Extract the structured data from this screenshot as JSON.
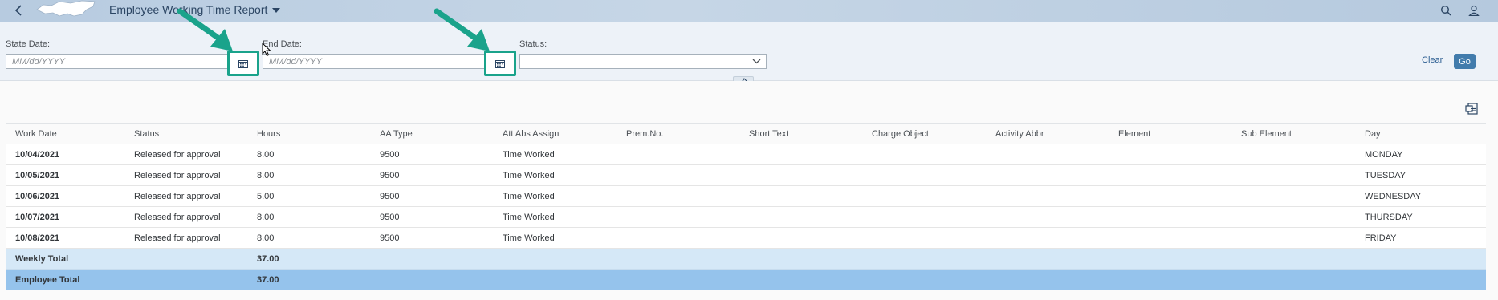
{
  "header": {
    "title": "Employee Working Time Report"
  },
  "filters": {
    "start_label": "State Date:",
    "start_placeholder": "MM/dd/YYYY",
    "end_label": "End Date:",
    "end_placeholder": "MM/dd/YYYY",
    "status_label": "Status:",
    "status_value": "",
    "clear_label": "Clear",
    "go_label": "Go"
  },
  "table": {
    "columns": [
      "Work Date",
      "Status",
      "Hours",
      "AA Type",
      "Att Abs Assign",
      "Prem.No.",
      "Short Text",
      "Charge Object",
      "Activity Abbr",
      "Element",
      "Sub Element",
      "Day"
    ],
    "rows": [
      [
        "10/04/2021",
        "Released for approval",
        "8.00",
        "9500",
        "Time Worked",
        "",
        "",
        "",
        "",
        "",
        "",
        "MONDAY"
      ],
      [
        "10/05/2021",
        "Released for approval",
        "8.00",
        "9500",
        "Time Worked",
        "",
        "",
        "",
        "",
        "",
        "",
        "TUESDAY"
      ],
      [
        "10/06/2021",
        "Released for approval",
        "5.00",
        "9500",
        "Time Worked",
        "",
        "",
        "",
        "",
        "",
        "",
        "WEDNESDAY"
      ],
      [
        "10/07/2021",
        "Released for approval",
        "8.00",
        "9500",
        "Time Worked",
        "",
        "",
        "",
        "",
        "",
        "",
        "THURSDAY"
      ],
      [
        "10/08/2021",
        "Released for approval",
        "8.00",
        "9500",
        "Time Worked",
        "",
        "",
        "",
        "",
        "",
        "",
        "FRIDAY"
      ]
    ],
    "weekly_total_label": "Weekly Total",
    "weekly_total_hours": "37.00",
    "employee_total_label": "Employee Total",
    "employee_total_hours": "37.00"
  },
  "colors": {
    "header_bg": "#c6d6e6",
    "accent": "#427cac",
    "highlight_border": "#1aa38b",
    "weekly_total_bg": "#d5e8f7",
    "employee_total_bg": "#95c3ec"
  },
  "icons": [
    "back-icon",
    "state-logo-icon",
    "search-icon",
    "user-icon",
    "calendar-icon",
    "chevron-down-icon",
    "pin-icon",
    "export-icon",
    "cursor-icon",
    "annotation-arrow-icon"
  ]
}
